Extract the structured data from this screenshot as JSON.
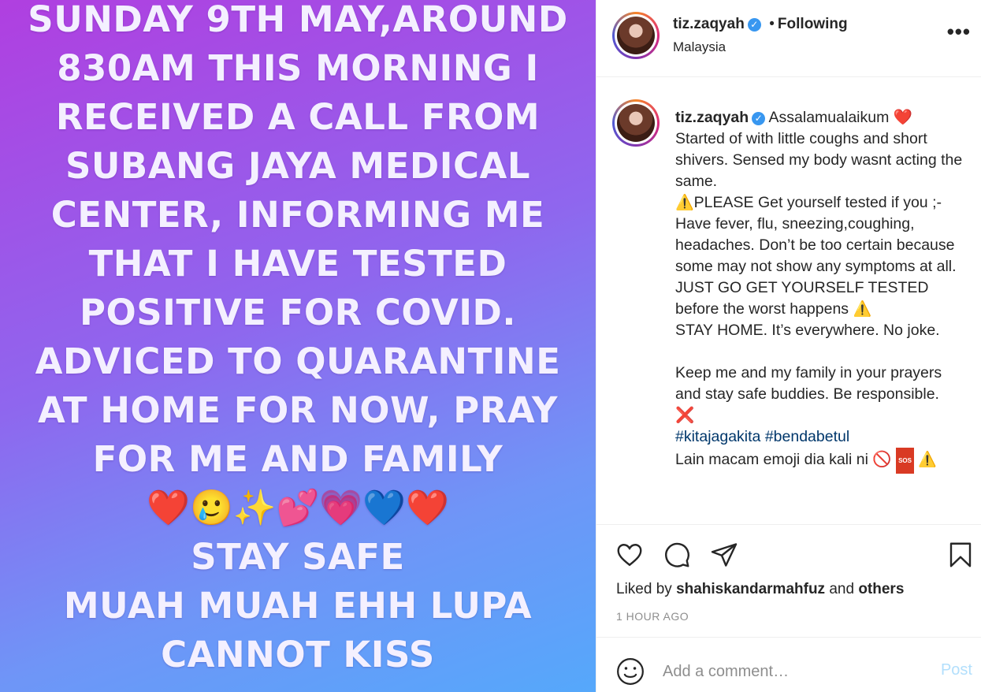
{
  "media": {
    "lines": [
      "SUNDAY 9TH MAY,AROUND",
      "830AM THIS MORNING I",
      "RECEIVED A CALL FROM",
      "SUBANG JAYA MEDICAL",
      "CENTER, INFORMING ME",
      "THAT I HAVE TESTED",
      "POSITIVE FOR COVID.",
      "ADVICED TO QUARANTINE",
      "AT HOME FOR NOW, PRAY",
      "FOR ME AND FAMILY"
    ],
    "emoji_row": "❤️🥲✨💕💗💙❤️",
    "lines_after": [
      "STAY SAFE",
      "MUAH MUAH EHH LUPA",
      "CANNOT KISS"
    ]
  },
  "header": {
    "username": "tiz.zaqyah",
    "separator": "•",
    "follow_status": "Following",
    "location": "Malaysia",
    "more_label": "•••"
  },
  "caption": {
    "username": "tiz.zaqyah",
    "greeting": "Assalamualaikum",
    "heart_emoji": "❤️",
    "line1": "Started of with little coughs and short shivers. Sensed my body wasnt acting the same.",
    "warning_emoji": "⚠️",
    "line2": "PLEASE Get yourself tested if you ;- Have fever, flu, sneezing,coughing, headaches. Don’t be too certain because some may not show any symptoms at all. JUST GO GET YOURSELF TESTED before the worst happens",
    "line3": "STAY HOME. It’s everywhere. No joke.",
    "line4": "Keep me and my family in your prayers and stay safe buddies. Be responsible.",
    "x_emoji": "❌",
    "hashtag1": "#kitajagakita",
    "hashtag2": "#bendabetul",
    "line5": "Lain macam emoji dia kali ni",
    "noentry_emoji": "🚫",
    "sos_label": "SOS"
  },
  "actions": {
    "liked_by_prefix": "Liked by",
    "liked_by_user": "shahiskandarmahfuz",
    "liked_by_and": "and",
    "liked_by_others": "others",
    "timestamp": "1 HOUR AGO"
  },
  "comment": {
    "placeholder": "Add a comment…",
    "post_label": "Post"
  },
  "colors": {
    "link": "#00376b",
    "verified": "#3897f0",
    "post_disabled": "#b2dffc",
    "muted": "#8e8e8e"
  }
}
